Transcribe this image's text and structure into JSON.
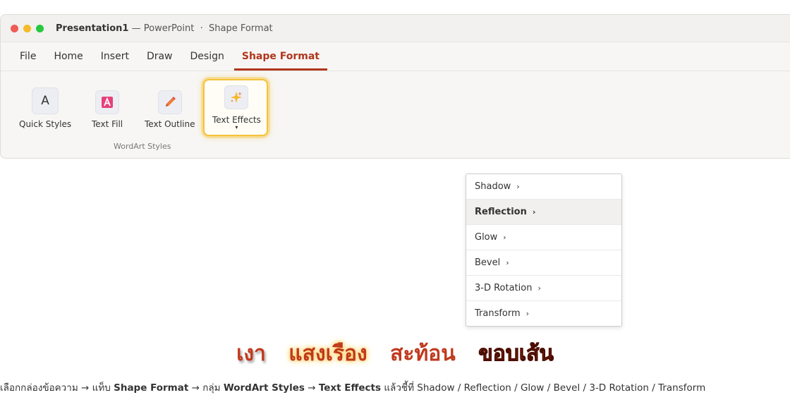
{
  "window": {
    "app_name": "Presentation1",
    "app_suffix": " — PowerPoint",
    "separator": "·",
    "context": "Shape Format",
    "traffic_colors": [
      "#ee5c55",
      "#f5bb2b",
      "#27c840"
    ]
  },
  "tabs": [
    {
      "label": "File"
    },
    {
      "label": "Home"
    },
    {
      "label": "Insert"
    },
    {
      "label": "Draw"
    },
    {
      "label": "Design"
    },
    {
      "label": "Shape Format",
      "active": true
    }
  ],
  "ribbon": {
    "quick_styles": {
      "label": "Quick Styles",
      "icon_text": "A"
    },
    "text_fill": {
      "label": "Text Fill",
      "icon": "text-fill-icon"
    },
    "text_outline": {
      "label": "Text Outline",
      "icon": "pencil-icon"
    },
    "text_effects": {
      "label": "Text Effects",
      "icon": "sparkle-icon",
      "caret": "▾"
    },
    "group_label": "WordArt Styles"
  },
  "menu": {
    "items": [
      {
        "label": "Shadow"
      },
      {
        "label": "Reflection",
        "selected": true
      },
      {
        "label": "Glow"
      },
      {
        "label": "Bevel"
      },
      {
        "label": "3-D Rotation"
      },
      {
        "label": "Transform"
      }
    ],
    "chevron": "›"
  },
  "demo_words": [
    "เงา",
    "แสงเรือง",
    "สะท้อน",
    "ขอบเส้น"
  ],
  "caption": {
    "part1": "เลือกกล่องข้อความ → แท็บ ",
    "b1": "Shape Format",
    "part2": " → กลุ่ม ",
    "b2": "WordArt Styles",
    "part3": " → ",
    "b3": "Text Effects",
    "part4": " แล้วชี้ที่ Shadow / Reflection / Glow / Bevel / 3-D Rotation / Transform"
  },
  "colors": {
    "accent": "#b0361c",
    "highlight": "#f5c23a"
  }
}
